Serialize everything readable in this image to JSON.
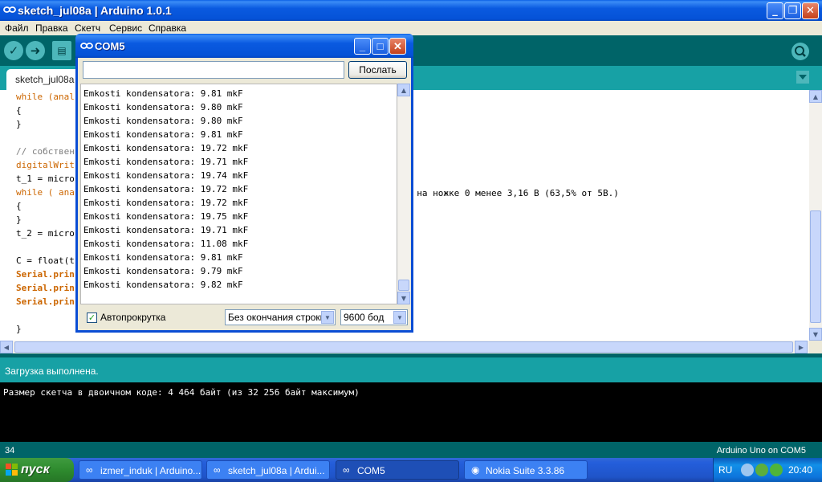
{
  "main_window": {
    "title": "sketch_jul08a | Arduino 1.0.1",
    "menu": [
      "Файл",
      "Правка",
      "Скетч",
      "Сервис",
      "Справка"
    ],
    "tab": "sketch_jul08a",
    "code_lines": [
      {
        "text": "while (anal",
        "cls": "kw"
      },
      {
        "text": "{",
        "cls": ""
      },
      {
        "text": "}",
        "cls": ""
      },
      {
        "text": "",
        "cls": ""
      },
      {
        "text": "// собствен",
        "cls": "cm"
      },
      {
        "text": "digitalWrit",
        "cls": "kw"
      },
      {
        "text": "t_1 = micro",
        "cls": ""
      },
      {
        "text": "while ( ana",
        "cls": "kw"
      },
      {
        "text": "{",
        "cls": ""
      },
      {
        "text": "}",
        "cls": ""
      },
      {
        "text": "t_2 = micro",
        "cls": ""
      },
      {
        "text": "",
        "cls": ""
      },
      {
        "text": "C = float(t",
        "cls": ""
      },
      {
        "text": "Serial.prin",
        "cls": "ser"
      },
      {
        "text": "Serial.prin",
        "cls": "ser"
      },
      {
        "text": "Serial.prin",
        "cls": "ser"
      },
      {
        "text": "",
        "cls": ""
      },
      {
        "text": "}",
        "cls": ""
      }
    ],
    "code_comment_visible": "е на ножке 0 менее 3,16 В (63,5% от 5В.)",
    "status": "Загрузка выполнена.",
    "console": "Размер скетча в двоичном коде: 4 464 байт (из 32 256 байт максимум)",
    "line_number": "34",
    "board": "Arduino Uno on COM5"
  },
  "serial_monitor": {
    "title": "COM5",
    "input_value": "",
    "send_label": "Послать",
    "output": [
      "Emkosti kondensatora: 9.81 mkF",
      "Emkosti kondensatora: 9.80 mkF",
      "Emkosti kondensatora: 9.80 mkF",
      "Emkosti kondensatora: 9.81 mkF",
      "Emkosti kondensatora: 19.72 mkF",
      "Emkosti kondensatora: 19.71 mkF",
      "Emkosti kondensatora: 19.74 mkF",
      "Emkosti kondensatora: 19.72 mkF",
      "Emkosti kondensatora: 19.72 mkF",
      "Emkosti kondensatora: 19.75 mkF",
      "Emkosti kondensatora: 19.71 mkF",
      "Emkosti kondensatora: 11.08 mkF",
      "Emkosti kondensatora: 9.81 mkF",
      "Emkosti kondensatora: 9.79 mkF",
      "Emkosti kondensatora: 9.82 mkF"
    ],
    "autoscroll_label": "Автопрокрутка",
    "autoscroll_checked": true,
    "line_ending": "Без окончания строки",
    "baud": "9600 бод"
  },
  "taskbar": {
    "start_label": "пуск",
    "tasks": [
      {
        "label": "izmer_induk | Arduino...",
        "active": false
      },
      {
        "label": "sketch_jul08a | Ardui...",
        "active": false
      },
      {
        "label": "COM5",
        "active": true
      },
      {
        "label": "Nokia Suite 3.3.86",
        "active": false
      }
    ],
    "lang": "RU",
    "clock": "20:40"
  },
  "colors": {
    "arduino_dark": "#006468",
    "arduino_light": "#17a1a5",
    "xp_blue": "#0a5ae0",
    "start_green": "#2e8b2e"
  }
}
